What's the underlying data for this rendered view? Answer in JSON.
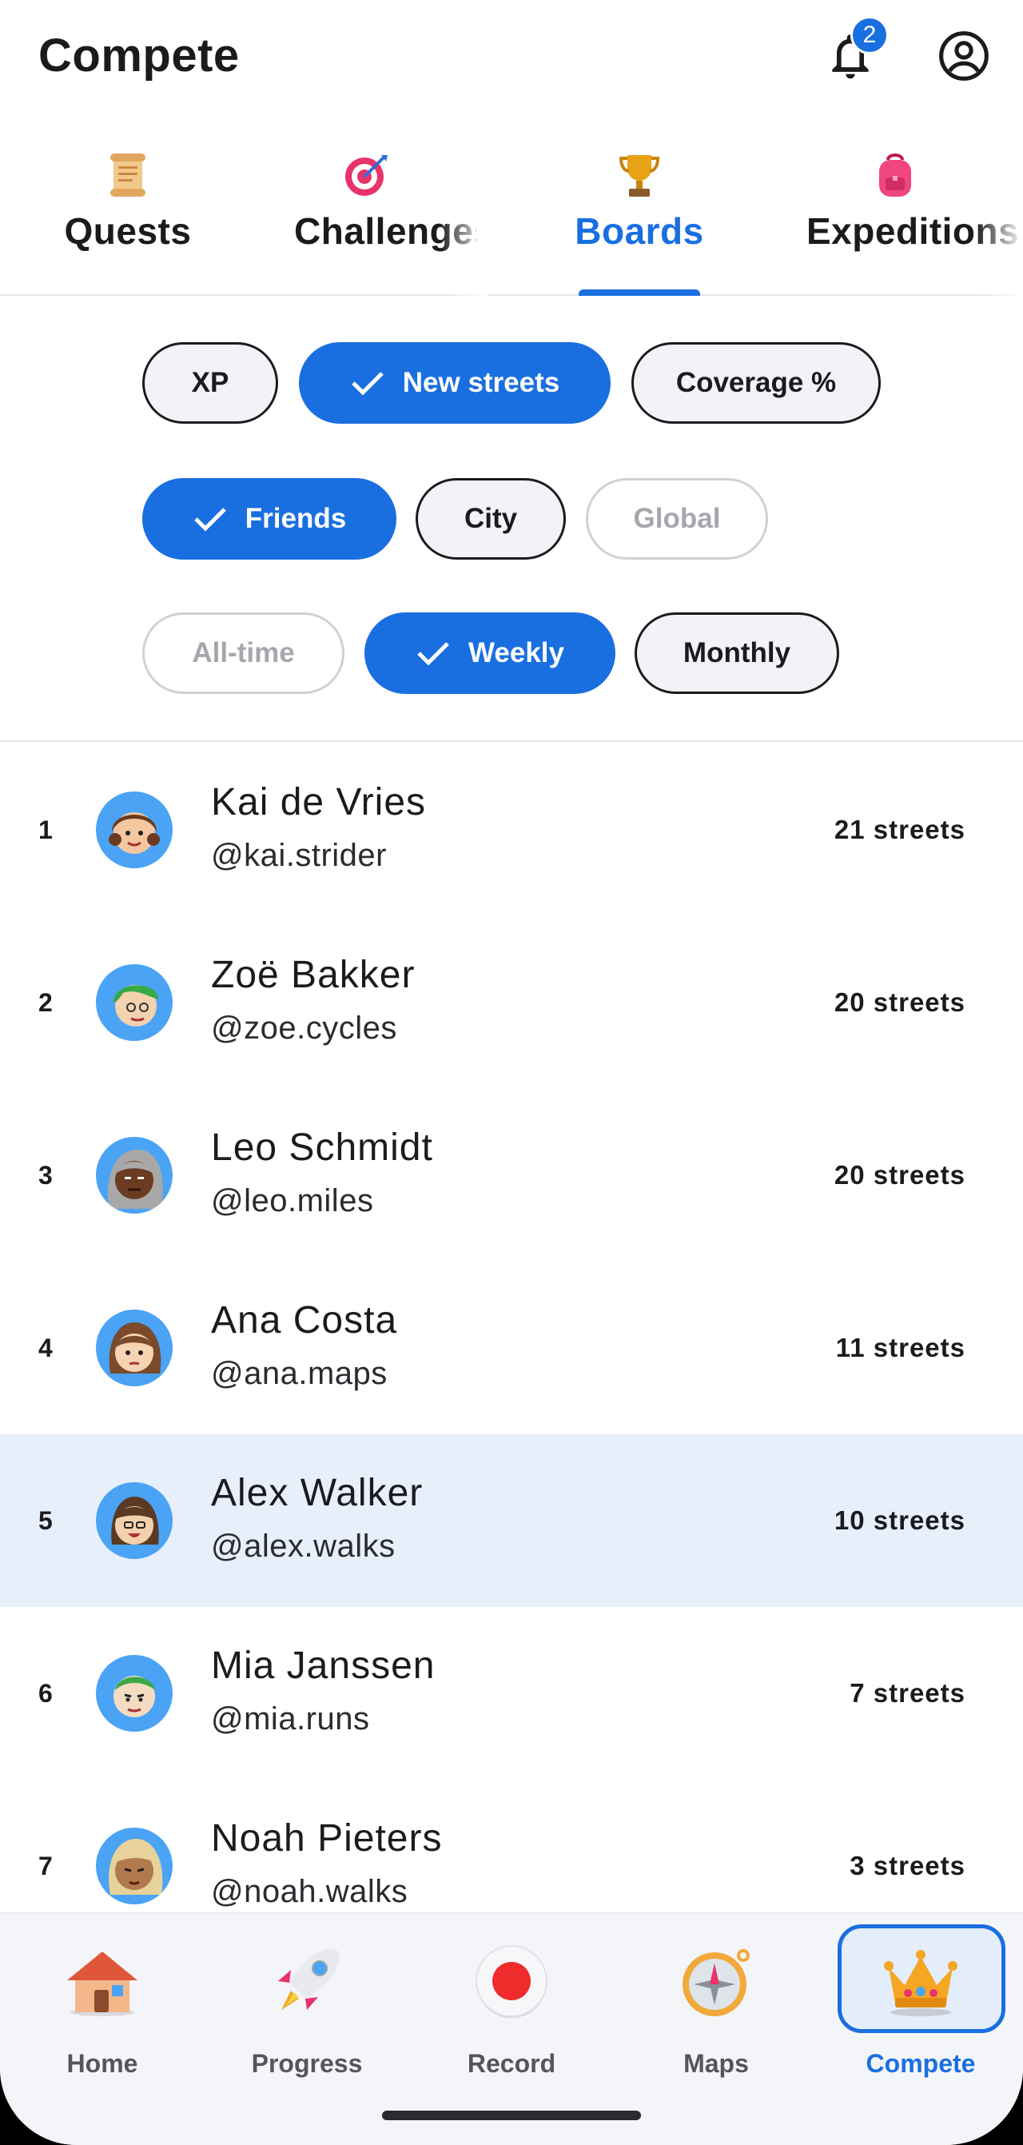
{
  "appbar": {
    "title": "Compete",
    "notification_count": "2"
  },
  "tabs": [
    {
      "label": "Quests",
      "icon": "scroll-icon"
    },
    {
      "label": "Challenges",
      "icon": "target-icon"
    },
    {
      "label": "Boards",
      "icon": "trophy-icon",
      "active": true
    },
    {
      "label": "Expeditions",
      "icon": "backpack-icon"
    }
  ],
  "filters": {
    "metric": [
      {
        "label": "XP",
        "state": "unselected"
      },
      {
        "label": "New streets",
        "state": "selected"
      },
      {
        "label": "Coverage %",
        "state": "unselected"
      }
    ],
    "scope": [
      {
        "label": "Friends",
        "state": "selected"
      },
      {
        "label": "City",
        "state": "unselected"
      },
      {
        "label": "Global",
        "state": "disabled"
      }
    ],
    "period": [
      {
        "label": "All-time",
        "state": "disabled"
      },
      {
        "label": "Weekly",
        "state": "selected"
      },
      {
        "label": "Monthly",
        "state": "unselected"
      }
    ]
  },
  "leaderboard": [
    {
      "rank": "1",
      "name": "Kai de Vries",
      "handle": "@kai.strider",
      "score": "21 streets"
    },
    {
      "rank": "2",
      "name": "Zoë Bakker",
      "handle": "@zoe.cycles",
      "score": "20 streets"
    },
    {
      "rank": "3",
      "name": "Leo Schmidt",
      "handle": "@leo.miles",
      "score": "20 streets"
    },
    {
      "rank": "4",
      "name": "Ana Costa",
      "handle": "@ana.maps",
      "score": "11 streets"
    },
    {
      "rank": "5",
      "name": "Alex Walker",
      "handle": "@alex.walks",
      "score": "10 streets",
      "current_user": true
    },
    {
      "rank": "6",
      "name": "Mia Janssen",
      "handle": "@mia.runs",
      "score": "7 streets"
    },
    {
      "rank": "7",
      "name": "Noah Pieters",
      "handle": "@noah.walks",
      "score": "3 streets"
    }
  ],
  "bottom_nav": [
    {
      "label": "Home",
      "icon": "house-icon"
    },
    {
      "label": "Progress",
      "icon": "rocket-icon"
    },
    {
      "label": "Record",
      "icon": "record-icon"
    },
    {
      "label": "Maps",
      "icon": "compass-icon"
    },
    {
      "label": "Compete",
      "icon": "crown-icon",
      "active": true
    }
  ],
  "colors": {
    "accent": "#1a6fe0",
    "highlight_row": "#e7effb",
    "avatar_bg": "#4aa3f5"
  }
}
